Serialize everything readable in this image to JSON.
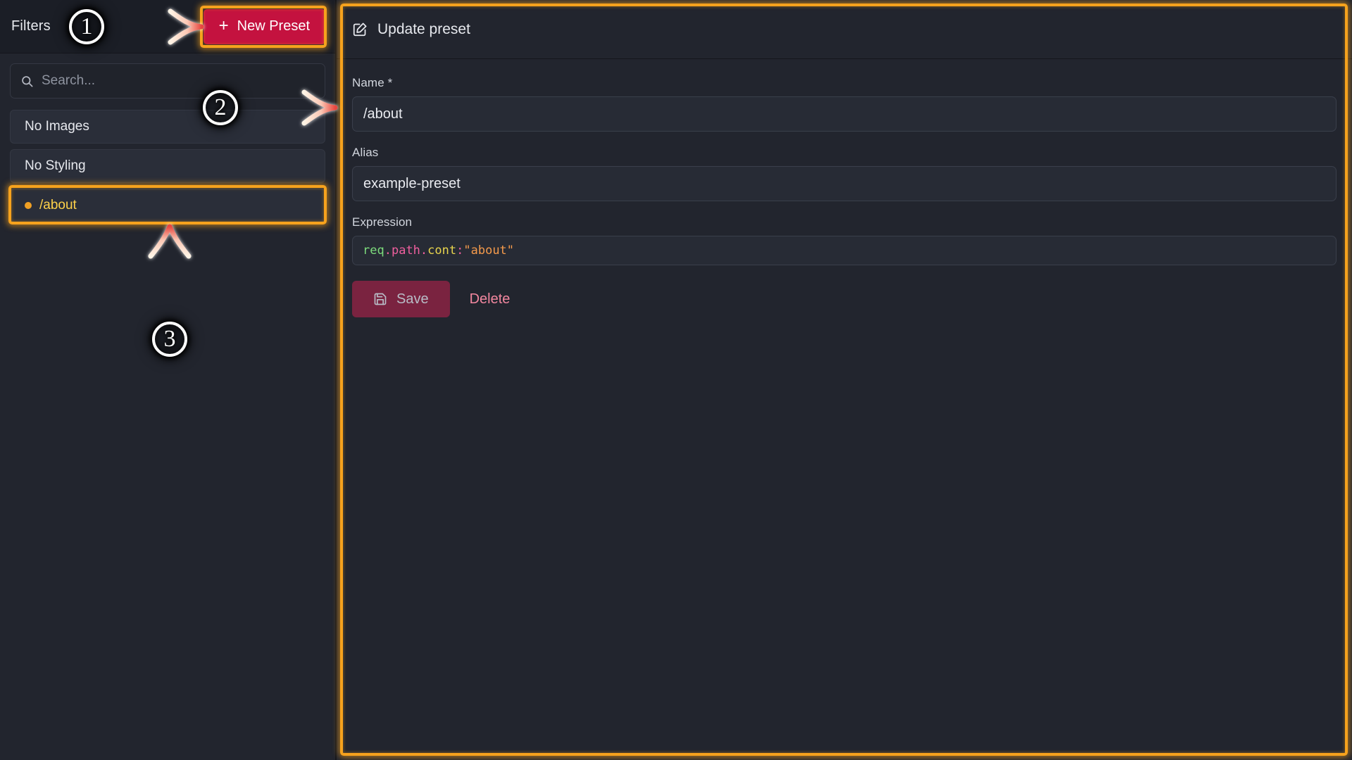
{
  "app": {
    "background": "#1b1e26",
    "accent_orange": "#f6a21d",
    "accent_crimson": "#c4123f"
  },
  "sidebar": {
    "header": {
      "title": "Filters",
      "new_preset_label": "New Preset",
      "new_preset_plus": "+"
    },
    "search": {
      "placeholder": "Search...",
      "value": "",
      "icon": "search-icon"
    },
    "items": [
      {
        "label": "No Images",
        "active": false
      },
      {
        "label": "No Styling",
        "active": false
      },
      {
        "label": "/about",
        "active": true
      }
    ]
  },
  "detail": {
    "header": {
      "icon": "pencil-square-icon",
      "title": "Update preset"
    },
    "fields": {
      "name": {
        "label": "Name",
        "required_mark": "*",
        "value": "/about",
        "placeholder": ""
      },
      "alias": {
        "label": "Alias",
        "value": "example-preset",
        "placeholder": ""
      },
      "expression": {
        "label": "Expression",
        "value": "req.path.cont:\"about\"",
        "tokens": [
          {
            "text": "req",
            "kind": "ident"
          },
          {
            "text": ".",
            "kind": "punct"
          },
          {
            "text": "path",
            "kind": "punct"
          },
          {
            "text": ".",
            "kind": "punct"
          },
          {
            "text": "cont",
            "kind": "key"
          },
          {
            "text": ":",
            "kind": "punct"
          },
          {
            "text": "\"about\"",
            "kind": "str"
          }
        ]
      }
    },
    "actions": {
      "save_label": "Save",
      "save_icon": "floppy-disk-icon",
      "delete_label": "Delete"
    }
  },
  "annotations": {
    "steps": [
      {
        "number": "①",
        "target": "new-preset-button"
      },
      {
        "number": "②",
        "target": "preset-list"
      },
      {
        "number": "③",
        "target": "preset-item-about"
      }
    ]
  }
}
